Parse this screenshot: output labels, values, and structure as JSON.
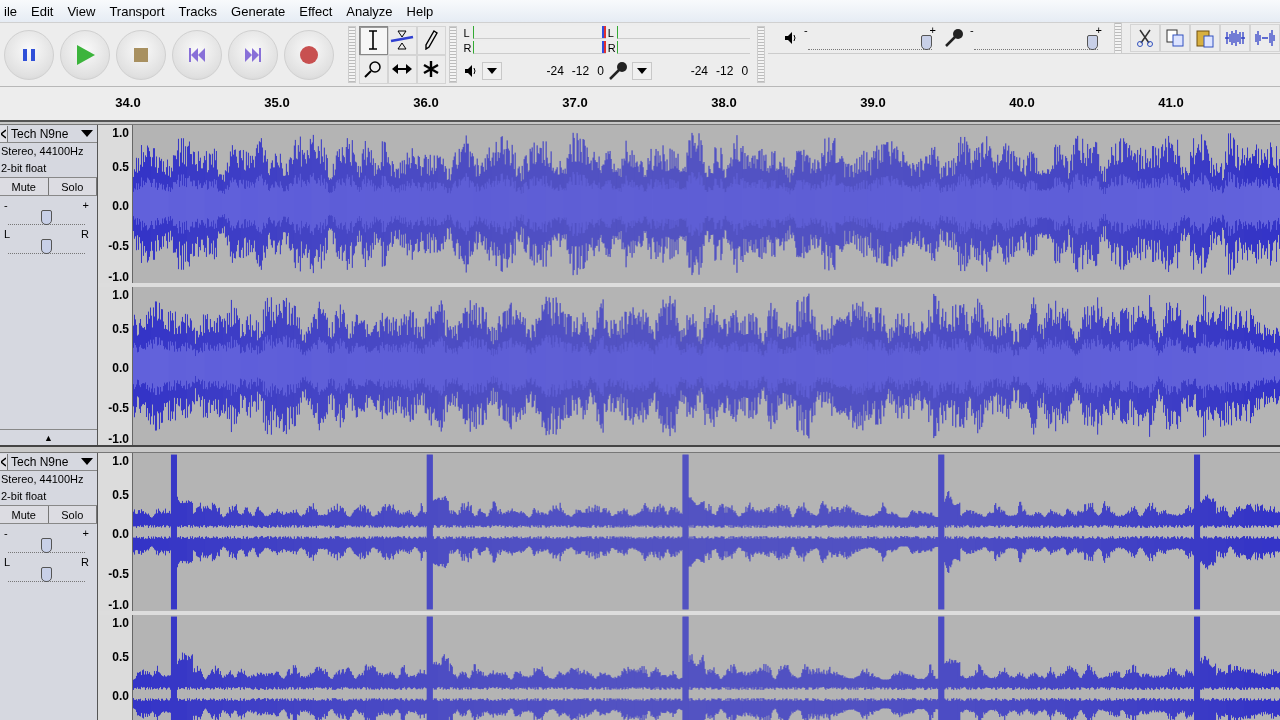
{
  "menu": [
    "ile",
    "Edit",
    "View",
    "Transport",
    "Tracks",
    "Generate",
    "Effect",
    "Analyze",
    "Help"
  ],
  "transport": [
    {
      "kind": "pause"
    },
    {
      "kind": "play"
    },
    {
      "kind": "stop"
    },
    {
      "kind": "start"
    },
    {
      "kind": "end"
    },
    {
      "kind": "record"
    }
  ],
  "tools": [
    {
      "kind": "select",
      "selected": true
    },
    {
      "kind": "envelope",
      "selected": false
    },
    {
      "kind": "draw",
      "selected": false
    },
    {
      "kind": "zoom",
      "selected": false
    },
    {
      "kind": "timeshift",
      "selected": false
    },
    {
      "kind": "multi",
      "selected": false
    }
  ],
  "meters": [
    {
      "kind": "playback",
      "channels": [
        "L",
        "R"
      ],
      "scale": [
        "-24",
        "-12",
        "0"
      ]
    },
    {
      "kind": "record",
      "channels": [
        "L",
        "R"
      ],
      "scale": [
        "-24",
        "-12",
        "0"
      ]
    }
  ],
  "mixer": [
    {
      "kind": "output",
      "min": "-",
      "max": "+",
      "level": 1
    },
    {
      "kind": "input",
      "min": "-",
      "max": "+",
      "level": 1
    }
  ],
  "edit_tools": [
    {
      "kind": "cut"
    },
    {
      "kind": "copy"
    },
    {
      "kind": "paste"
    },
    {
      "kind": "trim"
    },
    {
      "kind": "silence"
    }
  ],
  "ruler": [
    "34.0",
    "35.0",
    "36.0",
    "37.0",
    "38.0",
    "39.0",
    "40.0",
    "41.0"
  ],
  "tracks": [
    {
      "name": "Tech N9ne",
      "info": [
        "Stereo, 44100Hz",
        "2-bit float"
      ],
      "mute": "Mute",
      "solo": "Solo",
      "muted": false,
      "soloed": false,
      "gain": {
        "min": "-",
        "max": "+",
        "level": 0.5
      },
      "pan": {
        "min": "L",
        "max": "R",
        "level": 0.5
      },
      "collapse": "▲",
      "kind": "dense",
      "channels": [
        {
          "scale": [
            "1.0",
            "0.5",
            "0.0",
            "-0.5",
            "-1.0"
          ]
        },
        {
          "scale": [
            "1.0",
            "0.5",
            "0.0",
            "-0.5",
            "-1.0"
          ]
        }
      ]
    },
    {
      "name": "Tech N9ne",
      "info": [
        "Stereo, 44100Hz",
        "2-bit float"
      ],
      "mute": "Mute",
      "solo": "Solo",
      "muted": false,
      "soloed": false,
      "gain": {
        "min": "-",
        "max": "+",
        "level": 0.5
      },
      "pan": {
        "min": "L",
        "max": "R",
        "level": 0.5
      },
      "kind": "spiky",
      "channels": [
        {
          "scale": [
            "1.0",
            "0.5",
            "0.0",
            "-0.5",
            "-1.0"
          ]
        },
        {
          "scale": [
            "1.0",
            "0.5",
            "0.0"
          ]
        }
      ]
    }
  ]
}
